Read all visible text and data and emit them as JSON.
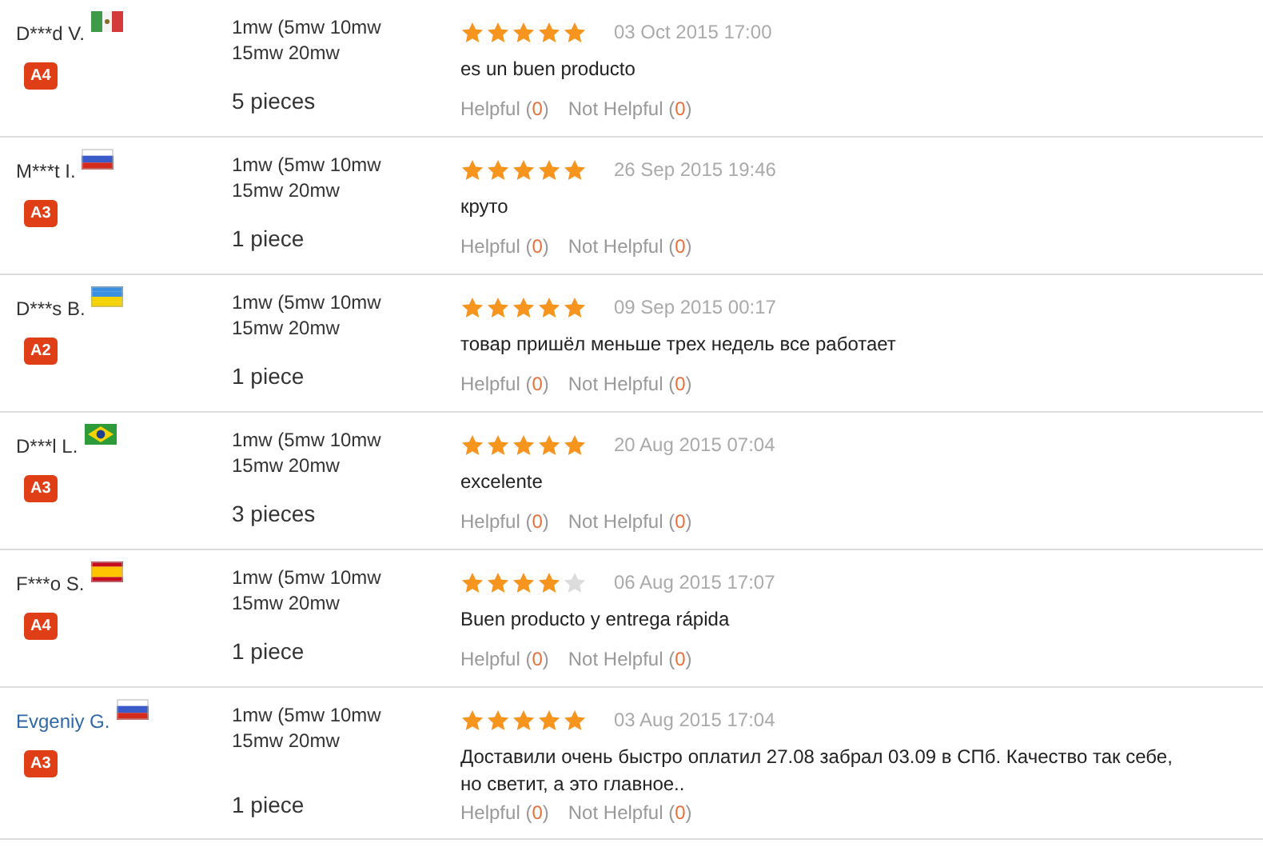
{
  "reviews": [
    {
      "name": "D***d V.",
      "link": false,
      "flag": {
        "kind": "mx"
      },
      "level_badge": "A4",
      "variant": "1mw (5mw 10mw 15mw 20mw",
      "quantity": "5 pieces",
      "stars": 5,
      "date": "03 Oct 2015 17:00",
      "text": "es un buen producto",
      "helpful": {
        "label": "Helpful",
        "count": "(0)"
      },
      "not_helpful": {
        "label": "Not Helpful",
        "count": "(0)"
      }
    },
    {
      "name": "M***t I.",
      "link": false,
      "flag": {
        "kind": "ru"
      },
      "level_badge": "A3",
      "variant": "1mw (5mw 10mw 15mw 20mw",
      "quantity": "1 piece",
      "stars": 5,
      "date": "26 Sep 2015 19:46",
      "text": "круто",
      "helpful": {
        "label": "Helpful",
        "count": "(0)"
      },
      "not_helpful": {
        "label": "Not Helpful",
        "count": "(0)"
      }
    },
    {
      "name": "D***s B.",
      "link": false,
      "flag": {
        "kind": "ua"
      },
      "level_badge": "A2",
      "variant": "1mw (5mw 10mw 15mw 20mw",
      "quantity": "1 piece",
      "stars": 5,
      "date": "09 Sep 2015 00:17",
      "text": "товар пришёл меньше трех недель все работает",
      "helpful": {
        "label": "Helpful",
        "count": "(0)"
      },
      "not_helpful": {
        "label": "Not Helpful",
        "count": "(0)"
      }
    },
    {
      "name": "D***l L.",
      "link": false,
      "flag": {
        "kind": "br"
      },
      "level_badge": "A3",
      "variant": "1mw (5mw 10mw 15mw 20mw",
      "quantity": "3 pieces",
      "stars": 5,
      "date": "20 Aug 2015 07:04",
      "text": "excelente",
      "helpful": {
        "label": "Helpful",
        "count": "(0)"
      },
      "not_helpful": {
        "label": "Not Helpful",
        "count": "(0)"
      }
    },
    {
      "name": "F***o S.",
      "link": false,
      "flag": {
        "kind": "es"
      },
      "level_badge": "A4",
      "variant": "1mw (5mw 10mw 15mw 20mw",
      "quantity": "1 piece",
      "stars": 4,
      "date": "06 Aug 2015 17:07",
      "text": "Buen producto y entrega rápida",
      "helpful": {
        "label": "Helpful",
        "count": "(0)"
      },
      "not_helpful": {
        "label": "Not Helpful",
        "count": "(0)"
      }
    },
    {
      "name": "Evgeniy G.",
      "link": true,
      "flag": {
        "kind": "ru"
      },
      "level_badge": "A3",
      "variant": "1mw (5mw 10mw 15mw 20mw",
      "quantity": "1 piece",
      "stars": 5,
      "date": "03 Aug 2015 17:04",
      "text": "Доставили очень быстро оплатил 27.08 забрал 03.09 в СПб. Качество так себе, но светит, а это главное..",
      "helpful": {
        "label": "Helpful",
        "count": "(0)"
      },
      "not_helpful": {
        "label": "Not Helpful",
        "count": "(0)"
      }
    }
  ]
}
